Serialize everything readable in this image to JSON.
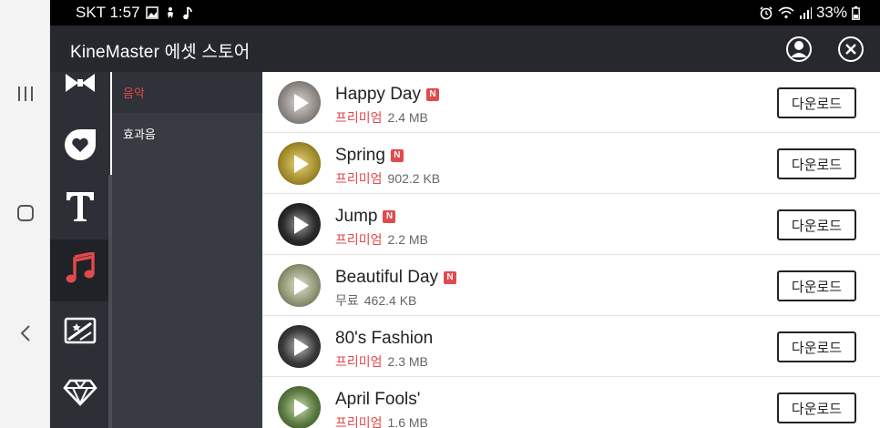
{
  "status_bar": {
    "carrier_time": "SKT 1:57",
    "battery": "33%"
  },
  "header": {
    "title": "KineMaster 에셋 스토어"
  },
  "categories": [
    {
      "icon": "transition-bowtie-icon",
      "active": false
    },
    {
      "icon": "sticker-heart-icon",
      "active": false
    },
    {
      "icon": "text-T-icon",
      "active": false
    },
    {
      "icon": "music-note-icon",
      "active": true
    },
    {
      "icon": "effect-image-icon",
      "active": false
    },
    {
      "icon": "premium-diamond-icon",
      "active": false
    }
  ],
  "subcategories": [
    {
      "label": "음악",
      "active": true
    },
    {
      "label": "효과음",
      "active": false
    }
  ],
  "assets": [
    {
      "name": "Happy Day",
      "new_badge": "N",
      "tier": "프리미엄",
      "size": "2.4 MB",
      "download_label": "다운로드",
      "thumb_color": "#8a8580"
    },
    {
      "name": "Spring",
      "new_badge": "N",
      "tier": "프리미엄",
      "size": "902.2 KB",
      "download_label": "다운로드",
      "thumb_color": "#a08a2a"
    },
    {
      "name": "Jump",
      "new_badge": "N",
      "tier": "프리미엄",
      "size": "2.2 MB",
      "download_label": "다운로드",
      "thumb_color": "#2a2a2a"
    },
    {
      "name": "Beautiful Day",
      "new_badge": "N",
      "tier": "무료",
      "size": "462.4 KB",
      "download_label": "다운로드",
      "thumb_color": "#8c9270"
    },
    {
      "name": "80's Fashion",
      "new_badge": "",
      "tier": "프리미엄",
      "size": "2.3 MB",
      "download_label": "다운로드",
      "thumb_color": "#3a3a3a"
    },
    {
      "name": "April Fools'",
      "new_badge": "",
      "tier": "프리미엄",
      "size": "1.6 MB",
      "download_label": "다운로드",
      "thumb_color": "#5a7a40"
    }
  ],
  "colors": {
    "accent": "#e2494c",
    "header_bg": "#26282d",
    "rail_bg": "#2c2f35",
    "subpanel_bg": "#383b42"
  }
}
